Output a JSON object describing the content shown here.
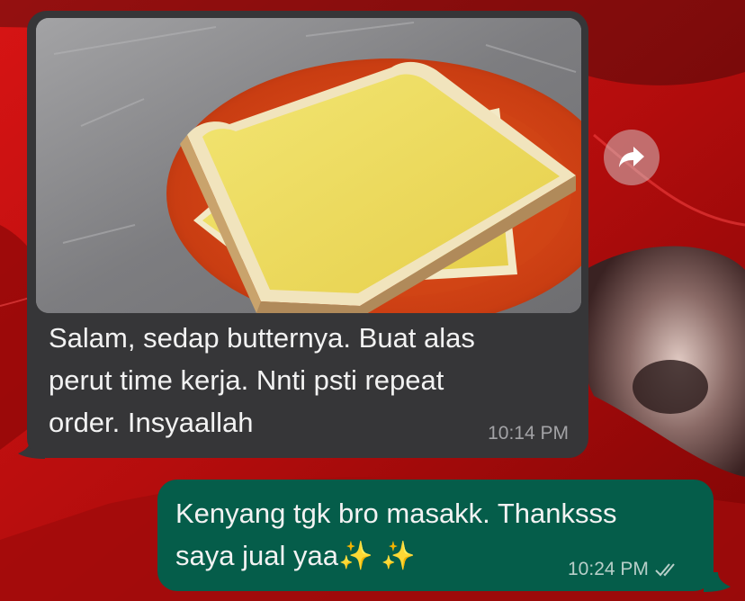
{
  "chat": {
    "messages": [
      {
        "direction": "incoming",
        "text": "Salam, sedap butternya. Buat alas\nperut time kerja. Nnti psti repeat\norder. Insyaallah",
        "time": "10:14 PM"
      },
      {
        "direction": "outgoing",
        "text": "Kenyang tgk bro masakk. Thanksss\nsaya jual yaa✨ ✨",
        "time": "10:24 PM",
        "status_icon": "double-check-icon"
      }
    ],
    "forward_icon": "forward-arrow-icon"
  },
  "colors": {
    "incoming_bubble": "#363638",
    "outgoing_bubble": "#055d4a",
    "wallpaper": "#b80f0f"
  }
}
